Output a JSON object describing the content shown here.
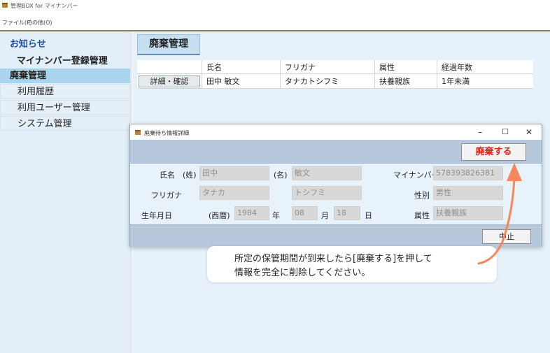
{
  "app": {
    "title": "管理BOX for マイナンバー",
    "menu": [
      "ファイル(F)",
      "その他(O)"
    ]
  },
  "sidebar": {
    "notice": "お知らせ",
    "items": [
      {
        "label": "マイナンバー登録管理"
      },
      {
        "label": "廃棄管理"
      },
      {
        "label": "利用履歴"
      },
      {
        "label": "利用ユーザー管理"
      },
      {
        "label": "システム管理"
      }
    ]
  },
  "main": {
    "tab": "廃棄管理",
    "columns": [
      "",
      "氏名",
      "フリガナ",
      "属性",
      "経過年数"
    ],
    "rows": [
      {
        "action": "詳細・確認",
        "name": "田中 敏文",
        "kana": "タナカトシフミ",
        "attr": "扶養親族",
        "years": "1年未満"
      }
    ]
  },
  "dialog": {
    "title": "廃棄待ち情報詳細",
    "controls": [
      "–",
      "☐",
      "✕"
    ],
    "discard_label": "廃棄する",
    "cancel_label": "中止",
    "labels": {
      "name": "氏名",
      "sei": "(姓)",
      "mei": "(名)",
      "mynumber": "マイナンバー",
      "kana": "フリガナ",
      "gender": "性別",
      "birth": "生年月日",
      "era": "(西暦)",
      "year": "年",
      "month": "月",
      "day": "日",
      "attr": "属性"
    },
    "values": {
      "sei": "田中",
      "mei": "敏文",
      "mynumber": "578393826381",
      "kana_sei": "タナカ",
      "kana_mei": "トシフミ",
      "gender": "男性",
      "year": "1984",
      "month": "08",
      "day": "18",
      "attr": "扶養親族"
    }
  },
  "callout": {
    "line1": "所定の保管期間が到来したら[廃棄する]を押して",
    "line2": "情報を完全に削除してください。"
  },
  "colors": {
    "accent_arrow": "#f5875a",
    "discard_text": "#e0241a",
    "selected_nav": "#a8d4ee"
  }
}
